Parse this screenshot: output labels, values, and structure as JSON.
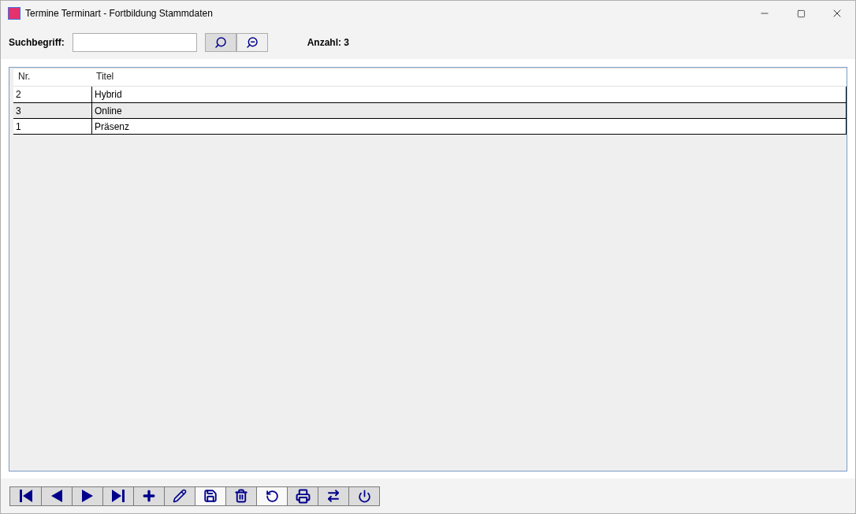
{
  "window": {
    "title": "Termine Terminart - Fortbildung Stammdaten"
  },
  "search": {
    "label": "Suchbegriff:",
    "count": "Anzahl: 3",
    "buttons": [
      {
        "kind": "search",
        "selected": true
      },
      {
        "kind": "zoom-out",
        "selected": false
      }
    ]
  },
  "table": {
    "columns": [
      "Nr.",
      "Titel"
    ],
    "rows": [
      [
        "2",
        "Hybrid"
      ],
      [
        "3",
        "Online"
      ],
      [
        "1",
        "Präsenz"
      ]
    ]
  },
  "toolbar": [
    {
      "kind": "first",
      "disabled": false
    },
    {
      "kind": "prev",
      "disabled": false
    },
    {
      "kind": "next",
      "disabled": false
    },
    {
      "kind": "last",
      "disabled": false
    },
    {
      "kind": "add",
      "disabled": false
    },
    {
      "kind": "edit",
      "disabled": false
    },
    {
      "kind": "save",
      "disabled": true
    },
    {
      "kind": "delete",
      "disabled": false
    },
    {
      "kind": "undo",
      "disabled": true
    },
    {
      "kind": "print",
      "disabled": false
    },
    {
      "kind": "swap",
      "disabled": false
    },
    {
      "kind": "power",
      "disabled": false
    }
  ]
}
